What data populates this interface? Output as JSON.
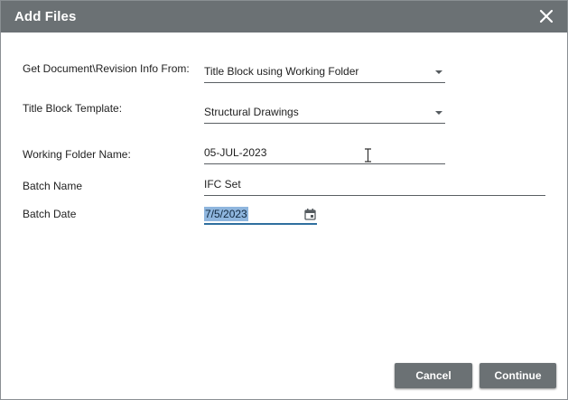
{
  "dialog": {
    "title": "Add Files",
    "close_icon": "close-icon"
  },
  "form": {
    "get_info_from": {
      "label": "Get Document\\Revision Info From:",
      "value": "Title Block using Working Folder"
    },
    "title_block_template": {
      "label": "Title Block Template:",
      "value": "Structural Drawings"
    },
    "working_folder_name": {
      "label": "Working Folder Name:",
      "value": "05-JUL-2023"
    },
    "batch_name": {
      "label": "Batch Name",
      "value": "IFC Set"
    },
    "batch_date": {
      "label": "Batch Date",
      "value": "7/5/2023",
      "icon": "calendar-icon"
    }
  },
  "buttons": {
    "cancel": "Cancel",
    "continue": "Continue"
  },
  "colors": {
    "titlebar": "#6b7174",
    "button": "#6b7174",
    "focus_underline": "#2f6f9f",
    "selection": "#8fb6de"
  }
}
